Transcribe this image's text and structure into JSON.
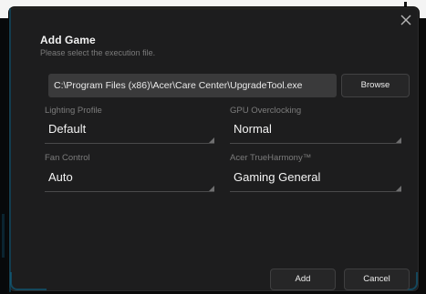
{
  "dialog": {
    "title": "Add Game",
    "subtitle": "Please select the execution file."
  },
  "path": {
    "value": "C:\\Program Files (x86)\\Acer\\Care Center\\UpgradeTool.exe",
    "browse_label": "Browse"
  },
  "fields": {
    "lighting_profile": {
      "label": "Lighting Profile",
      "value": "Default"
    },
    "gpu_overclocking": {
      "label": "GPU Overclocking",
      "value": "Normal"
    },
    "fan_control": {
      "label": "Fan Control",
      "value": "Auto"
    },
    "true_harmony": {
      "label": "Acer TrueHarmony™",
      "value": "Gaming General"
    }
  },
  "footer": {
    "add_label": "Add",
    "cancel_label": "Cancel"
  },
  "icons": {
    "close": "close-icon",
    "dropdown_corner": "dropdown-corner-icon"
  },
  "colors": {
    "dialog_bg": "#1d1d1e",
    "accent": "#0e6b8f",
    "text": "#f3f3f3",
    "muted": "#7c7c7c"
  }
}
